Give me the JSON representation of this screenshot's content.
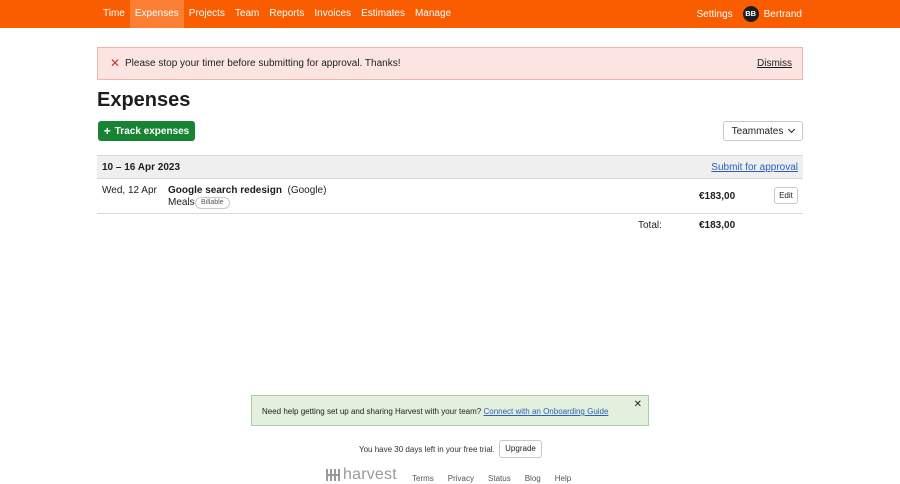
{
  "nav": {
    "items": [
      {
        "label": "Time"
      },
      {
        "label": "Expenses"
      },
      {
        "label": "Projects"
      },
      {
        "label": "Team"
      },
      {
        "label": "Reports"
      },
      {
        "label": "Invoices"
      },
      {
        "label": "Estimates"
      },
      {
        "label": "Manage"
      }
    ],
    "active": "Expenses",
    "settings": "Settings",
    "avatar_initials": "BB",
    "user_name": "Bertrand"
  },
  "alert": {
    "message": "Please stop your timer before submitting for approval. Thanks!",
    "dismiss": "Dismiss"
  },
  "page": {
    "title": "Expenses",
    "track_button": "Track expenses",
    "teammates_button": "Teammates"
  },
  "week": {
    "range": "10 – 16 Apr 2023",
    "submit_link": "Submit for approval",
    "entries": [
      {
        "date": "Wed, 12 Apr",
        "project": "Google search redesign",
        "client": "(Google)",
        "category": "Meals",
        "badge": "Billable",
        "amount": "€183,00",
        "edit": "Edit"
      }
    ],
    "total_label": "Total:",
    "total_amount": "€183,00"
  },
  "help": {
    "text": "Need help getting set up and sharing Harvest with your team?",
    "link": "Connect with an Onboarding Guide"
  },
  "trial": {
    "text": "You have 30 days left in your free trial.",
    "upgrade": "Upgrade"
  },
  "footer": {
    "logo": "harvest",
    "links": [
      "Terms",
      "Privacy",
      "Status",
      "Blog",
      "Help"
    ]
  },
  "colors": {
    "brand": "#fa5d00",
    "active_tab": "#fb7e35",
    "primary_button": "#188433",
    "alert_bg": "#fce4e2",
    "help_bg": "#e3f0dd",
    "link": "#2b5dbf"
  }
}
